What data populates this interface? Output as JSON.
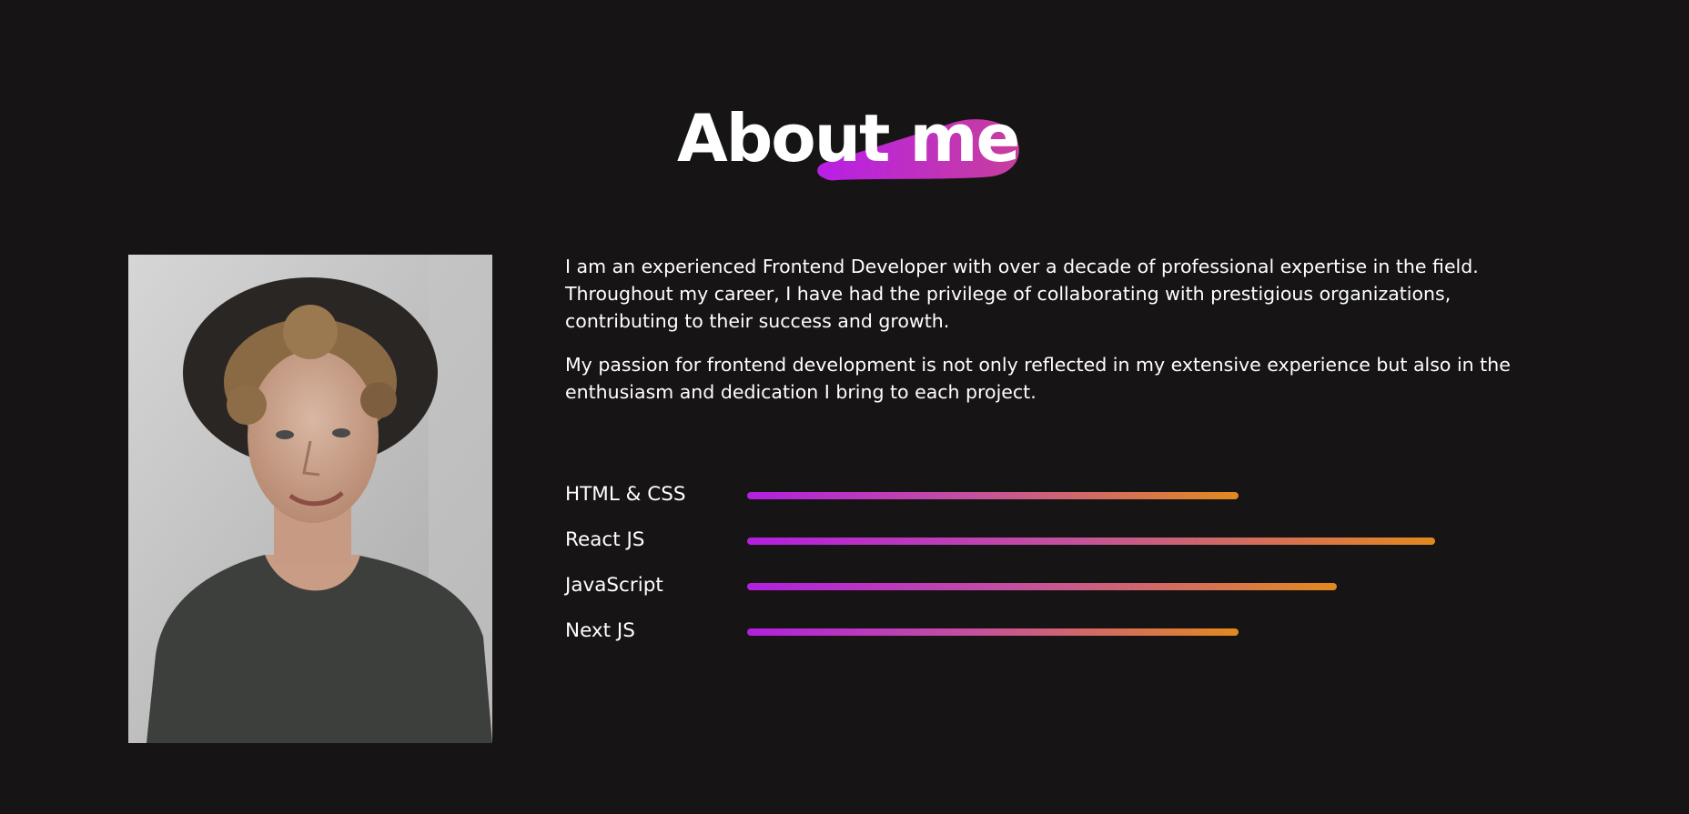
{
  "section": {
    "title": "About me"
  },
  "profile_photo": {
    "alt": "Portrait of a smiling man with curly hair wearing a black hat"
  },
  "paragraphs": [
    "I am an experienced Frontend Developer with over a decade of professional expertise in the field. Throughout my career, I have had the privilege of collaborating with prestigious organizations, contributing to their success and growth.",
    "My passion for frontend development is not only reflected in my extensive experience but also in the enthusiasm and dedication I bring to each project."
  ],
  "skills": [
    {
      "label": "HTML & CSS",
      "level": 0.6
    },
    {
      "label": "React JS",
      "level": 0.84
    },
    {
      "label": "JavaScript",
      "level": 0.72
    },
    {
      "label": "Next JS",
      "level": 0.6
    }
  ],
  "colors": {
    "background": "#161414",
    "accent_start": "#b21fe0",
    "accent_end": "#e2891f",
    "title_blob": "#c23ad0"
  }
}
